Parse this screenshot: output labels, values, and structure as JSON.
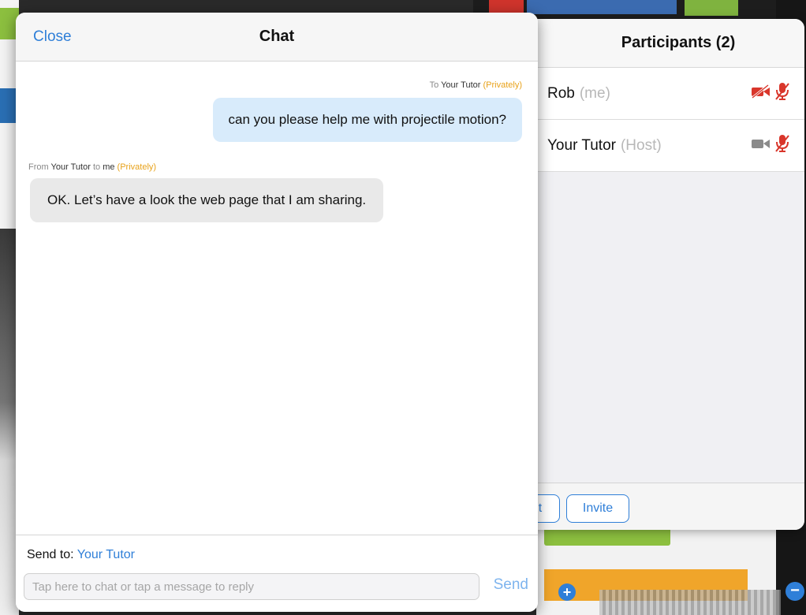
{
  "background": {
    "plus_glyph": "+",
    "minus_glyph": "−"
  },
  "participants": {
    "title": "Participants (2)",
    "list": [
      {
        "name": "Rob",
        "role": "(me)",
        "video": "video-off-icon",
        "mic": "mic-muted-icon"
      },
      {
        "name": "Your Tutor",
        "role": "(Host)",
        "video": "video-on-icon",
        "mic": "mic-muted-icon"
      }
    ],
    "left_button_label": "t",
    "invite_label": "Invite"
  },
  "chat": {
    "close_label": "Close",
    "title": "Chat",
    "messages": [
      {
        "direction": "outgoing",
        "meta_prefix": "To",
        "meta_target": "Your Tutor",
        "meta_private": "(Privately)",
        "text": "can you please help me with projectile motion?"
      },
      {
        "direction": "incoming",
        "meta_prefix": "From",
        "meta_sender": "Your Tutor",
        "meta_to": "to",
        "meta_recipient": "me",
        "meta_private": "(Privately)",
        "text": "OK. Let’s have a look the web page that I am sharing."
      }
    ],
    "send_to_label": "Send to:",
    "send_to_target": "Your Tutor",
    "input_placeholder": "Tap here to chat or tap a message to reply",
    "input_value": "",
    "send_label": "Send"
  },
  "colors": {
    "accent": "#2f7fd8",
    "outgoing_bubble": "#d8ebfb",
    "incoming_bubble": "#e9e9e9",
    "private_tag": "#e8a21a",
    "muted_red": "#d9362b"
  }
}
